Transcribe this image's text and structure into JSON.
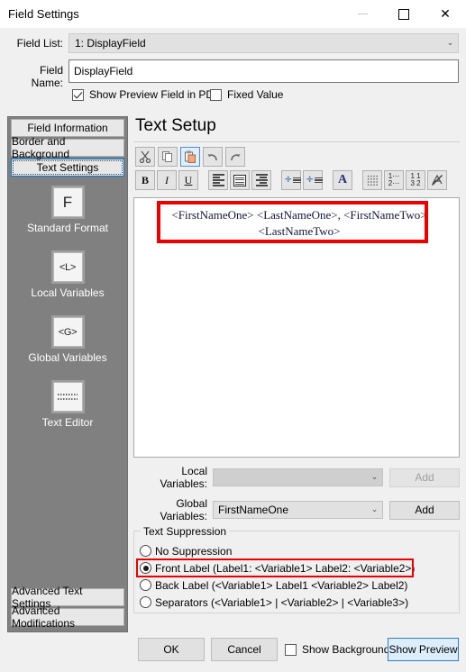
{
  "window": {
    "title": "Field Settings",
    "caption_buttons": [
      {
        "name": "minimize",
        "glyph": "—",
        "disabled": true
      },
      {
        "name": "maximize",
        "glyph": "□",
        "disabled": false
      },
      {
        "name": "close",
        "glyph": "✕",
        "disabled": false
      }
    ]
  },
  "topform": {
    "field_list_label": "Field List:",
    "field_list_value": "1: DisplayField",
    "field_name_label": "Field Name:",
    "field_name_value": "DisplayField",
    "show_preview_checkbox": {
      "label": "Show Preview Field in PDF",
      "checked": true
    },
    "fixed_value_checkbox": {
      "label": "Fixed Value",
      "checked": false
    }
  },
  "sidebar": {
    "tabs": [
      {
        "label": "Field Information",
        "selected": false
      },
      {
        "label": "Border and Background",
        "selected": false
      },
      {
        "label": "Text Settings",
        "selected": true
      }
    ],
    "icons": [
      {
        "label": "Standard Format",
        "glyph": "F",
        "icon": "format-F-icon"
      },
      {
        "label": "Local Variables",
        "glyph": "<L>",
        "icon": "local-variables-icon"
      },
      {
        "label": "Global Variables",
        "glyph": "<G>",
        "icon": "global-variables-icon"
      },
      {
        "label": "Text Editor",
        "glyph": "",
        "icon": "text-editor-icon"
      }
    ],
    "bottom_buttons": [
      {
        "label": "Advanced Text Settings"
      },
      {
        "label": "Advanced Modifications"
      }
    ]
  },
  "main": {
    "title": "Text Setup",
    "toolbar_row1": [
      {
        "name": "cut-icon",
        "glyph": "✂",
        "active": false
      },
      {
        "name": "copy-icon",
        "glyph": "❐",
        "active": false
      },
      {
        "name": "paste-icon",
        "glyph": "📋",
        "active": true
      },
      {
        "name": "undo-icon",
        "glyph": "↶",
        "active": false
      },
      {
        "name": "redo-icon",
        "glyph": "↷",
        "active": false
      }
    ],
    "toolbar_row2": [
      {
        "name": "bold-icon",
        "glyph": "B"
      },
      {
        "name": "italic-icon",
        "glyph": "I"
      },
      {
        "name": "underline-icon",
        "glyph": "U"
      },
      {
        "name": "align-left-icon",
        "glyph": ""
      },
      {
        "name": "align-justify-icon",
        "glyph": ""
      },
      {
        "name": "align-right-icon",
        "glyph": ""
      },
      {
        "name": "indent-increase-icon",
        "glyph": ""
      },
      {
        "name": "indent-decrease-icon",
        "glyph": ""
      },
      {
        "name": "font-color-icon",
        "glyph": "A"
      },
      {
        "name": "bullet-list-icon",
        "glyph": ""
      },
      {
        "name": "numbered-list-icon",
        "glyph": ""
      },
      {
        "name": "sort-icon",
        "glyph": ""
      },
      {
        "name": "clear-formatting-icon",
        "glyph": ""
      }
    ],
    "editor_text": "<FirstNameOne> <LastNameOne>, <FirstNameTwo> <LastNameTwo>",
    "local_variables_label": "Local Variables:",
    "local_variables_value": "",
    "local_variables_add": "Add",
    "global_variables_label": "Global Variables:",
    "global_variables_value": "FirstNameOne",
    "global_variables_add": "Add",
    "text_suppression": {
      "title": "Text Suppression",
      "options": [
        {
          "label": "No Suppression",
          "selected": false,
          "highlighted": false
        },
        {
          "label": "Front Label (Label1: <Variable1> Label2: <Variable2>)",
          "selected": true,
          "highlighted": true
        },
        {
          "label": "Back Label (<Variable1> Label1 <Variable2> Label2)",
          "selected": false,
          "highlighted": false
        },
        {
          "label": "Separators (<Variable1> | <Variable2> | <Variable3>)",
          "selected": false,
          "highlighted": false
        }
      ]
    }
  },
  "bottom": {
    "ok_label": "OK",
    "cancel_label": "Cancel",
    "show_background_checkbox": {
      "label": "Show Background",
      "checked": false
    },
    "show_preview_label": "Show Preview"
  },
  "colors": {
    "highlight_red": "#ee0000",
    "accent_blue": "#2f7fc4",
    "sidebar_gray": "#808080",
    "window_bg": "#f0f0f0"
  }
}
